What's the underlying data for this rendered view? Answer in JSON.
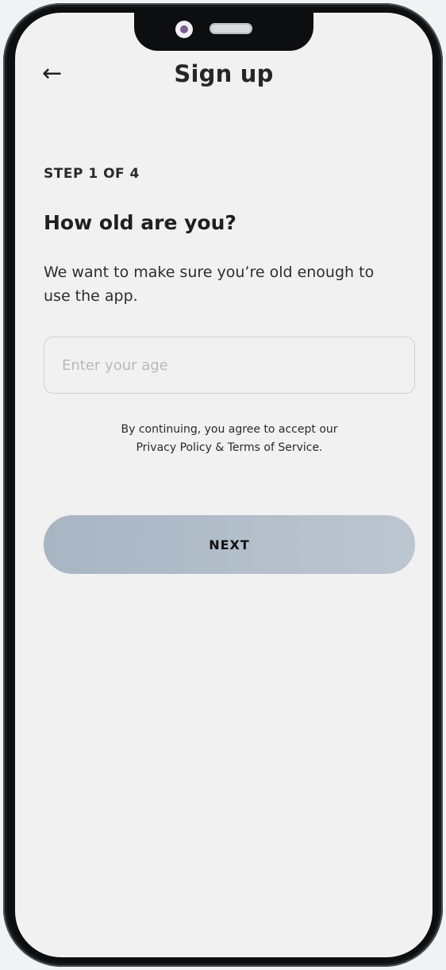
{
  "header": {
    "back_icon": "←",
    "title": "Sign up"
  },
  "step": {
    "label": "STEP 1 OF 4"
  },
  "question": {
    "title": "How old are you?",
    "description": "We want to make sure you’re old enough to use the app."
  },
  "age_input": {
    "placeholder": "Enter your age",
    "value": ""
  },
  "terms": {
    "line1": "By continuing, you agree to accept our",
    "line2": "Privacy Policy & Terms of Service."
  },
  "actions": {
    "next_label": "NEXT"
  },
  "colors": {
    "background": "#f1f1f1",
    "frame": "#0d0e10",
    "primary_button": "#b2bfcb"
  }
}
